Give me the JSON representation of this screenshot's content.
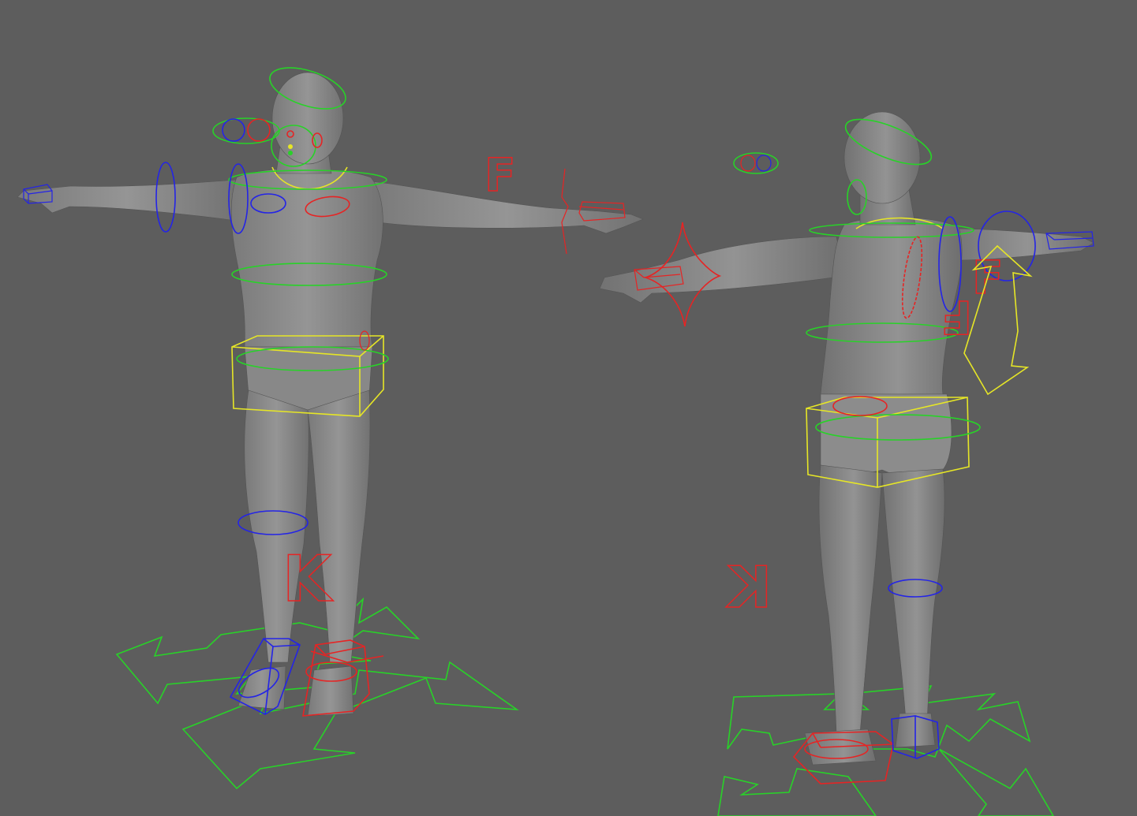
{
  "viewport": {
    "background": "#5d5d5d",
    "mesh_color": "#8a8a8a",
    "mesh_shade": "#6f6f6f"
  },
  "control_colors": {
    "fk_center": "#28d228",
    "left_side": "#2424e6",
    "right_side": "#e62424",
    "root_pivot": "#e6e626"
  },
  "front_view": {
    "fk_ik_switch_label": "F",
    "knee_label": "K"
  },
  "back_view": {
    "knee_label": "K",
    "fk_ik_switch_label": "F"
  },
  "icons": [
    "move-arrows-icon",
    "box-control-icon",
    "circle-control-icon",
    "star-control-icon"
  ]
}
